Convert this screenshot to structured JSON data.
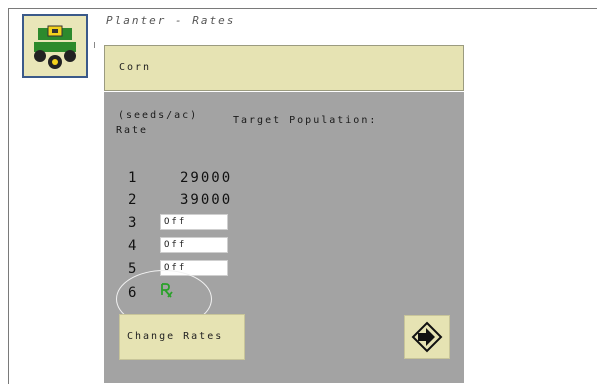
{
  "screen": {
    "title": "Planter - Rates"
  },
  "crop": {
    "label": "Corn"
  },
  "rates_table": {
    "units_label": "(seeds/ac)",
    "rate_label": "Rate",
    "target_label": "Target Population:",
    "rows": [
      {
        "num": "1",
        "value": "29000"
      },
      {
        "num": "2",
        "value": "39000"
      },
      {
        "num": "3",
        "value": "Off"
      },
      {
        "num": "4",
        "value": "Off"
      },
      {
        "num": "5",
        "value": "Off"
      },
      {
        "num": "6",
        "value": "Rx"
      }
    ]
  },
  "buttons": {
    "change_rates": "Change Rates"
  },
  "icons": {
    "app": "planter-icon",
    "prescription": "rx-icon",
    "next": "next-page-icon"
  },
  "colors": {
    "panel": "#a3a3a3",
    "button": "#e6e3b3",
    "rx": "#2aa12a"
  }
}
